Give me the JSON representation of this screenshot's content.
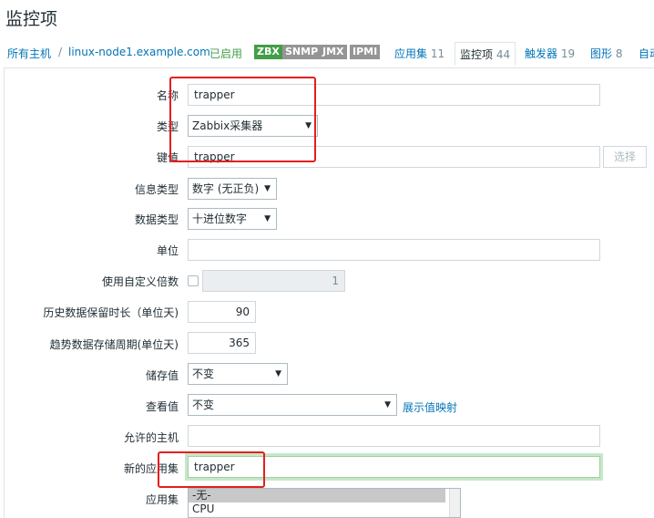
{
  "page_title": "监控项",
  "nav": {
    "all_hosts": "所有主机",
    "separator": "/",
    "host": "linux-node1.example.com",
    "status": "已启用",
    "tags": [
      "ZBX",
      "SNMP",
      "JMX",
      "IPMI"
    ],
    "applications_label": "应用集",
    "applications_count": "11",
    "items_label": "监控项",
    "items_count": "44",
    "triggers_label": "触发器",
    "triggers_count": "19",
    "graphs_label": "图形",
    "graphs_count": "8",
    "discovery_label": "自动"
  },
  "form": {
    "name_label": "名称",
    "name_value": "trapper",
    "type_label": "类型",
    "type_value": "Zabbix采集器",
    "key_label": "键值",
    "key_value": "trapper",
    "key_select_button": "选择",
    "info_type_label": "信息类型",
    "info_type_value": "数字 (无正负)",
    "data_type_label": "数据类型",
    "data_type_value": "十进位数字",
    "units_label": "单位",
    "units_value": "",
    "multiplier_label": "使用自定义倍数",
    "multiplier_value": "1",
    "history_label": "历史数据保留时长（单位天)",
    "history_value": "90",
    "trends_label": "趋势数据存储周期(单位天)",
    "trends_value": "365",
    "store_label": "储存值",
    "store_value": "不变",
    "show_label": "查看值",
    "show_value": "不变",
    "show_mapping_link": "展示值映射",
    "allowed_hosts_label": "允许的主机",
    "allowed_hosts_value": "",
    "new_app_label": "新的应用集",
    "new_app_value": "trapper",
    "apps_label": "应用集",
    "apps_options": [
      "-无-",
      "CPU"
    ]
  },
  "colors": {
    "link": "#0275b8",
    "enabled": "#429e47",
    "highlight": "#e51e1e"
  }
}
